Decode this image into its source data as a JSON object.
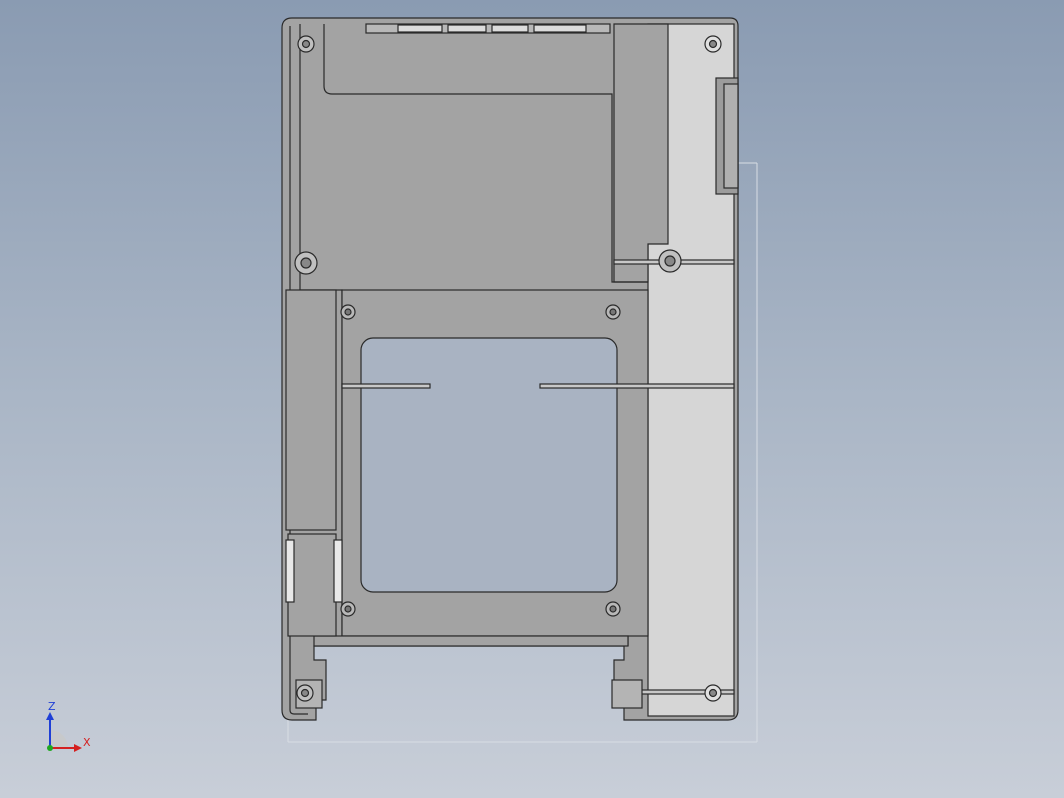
{
  "view": {
    "background_top": "#8a9bb2",
    "background_bottom": "#c8ced8",
    "part_fill": "#a3a3a3",
    "part_light_fill": "#d6d6d6",
    "edge_color": "#2a2a2a"
  },
  "triad": {
    "z_label": "Z",
    "x_label": "X",
    "z_color": "#1f3fd6",
    "x_color": "#d42020",
    "y_color": "#1fa81f"
  }
}
